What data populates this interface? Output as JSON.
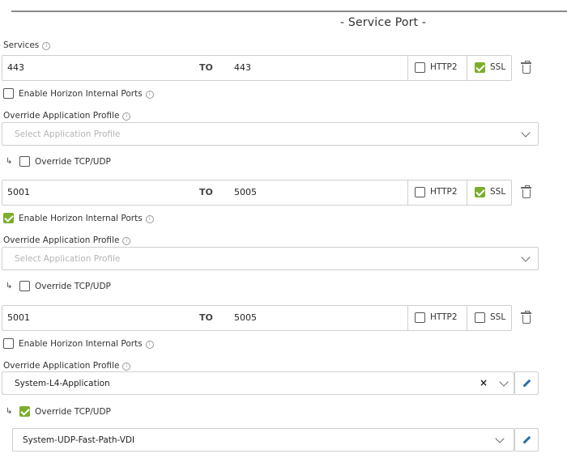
{
  "section_title": "- Service Port -",
  "services_label": "Services",
  "to_label": "TO",
  "http2_label": "HTTP2",
  "ssl_label": "SSL",
  "horizon_label": "Enable Horizon Internal Ports",
  "override_profile_label": "Override Application Profile",
  "override_tcp_label": "Override TCP/UDP",
  "rows": [
    {
      "from": "443",
      "to": "443",
      "http2": false,
      "ssl": true,
      "horizon": false,
      "profile_placeholder": "Select Application Profile",
      "profile_value": "",
      "override_tcp": false,
      "tcp_profile": ""
    },
    {
      "from": "5001",
      "to": "5005",
      "http2": false,
      "ssl": true,
      "horizon": true,
      "profile_placeholder": "Select Application Profile",
      "profile_value": "",
      "override_tcp": false,
      "tcp_profile": ""
    },
    {
      "from": "5001",
      "to": "5005",
      "http2": false,
      "ssl": false,
      "horizon": false,
      "profile_placeholder": "",
      "profile_value": "System-L4-Application",
      "override_tcp": true,
      "tcp_profile": "System-UDP-Fast-Path-VDI"
    }
  ],
  "icons": {
    "info": "info-icon",
    "delete": "trash-icon",
    "dropdown": "chevron-down-icon",
    "clear": "close-icon",
    "edit": "pencil-icon",
    "indent": "return-arrow-icon"
  },
  "colors": {
    "checked": "#7cae2c",
    "edit": "#2a6fa8",
    "border": "#cfcfcf"
  }
}
